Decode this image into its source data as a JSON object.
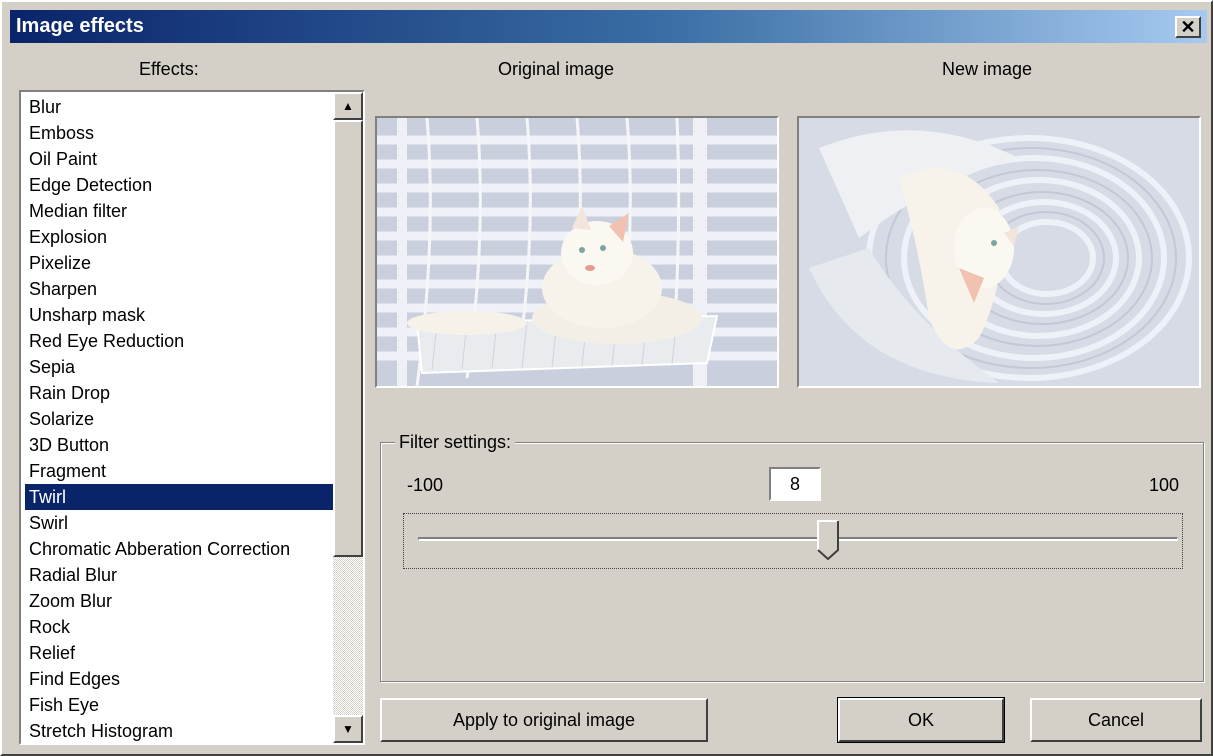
{
  "window": {
    "title": "Image effects",
    "close_glyph": "✕"
  },
  "headers": {
    "effects": "Effects:",
    "original": "Original image",
    "new": "New image"
  },
  "effects": {
    "items": [
      "Blur",
      "Emboss",
      "Oil Paint",
      "Edge Detection",
      "Median filter",
      "Explosion",
      "Pixelize",
      "Sharpen",
      "Unsharp mask",
      "Red Eye Reduction",
      "Sepia",
      "Rain Drop",
      "Solarize",
      "3D Button",
      "Fragment",
      "Twirl",
      "Swirl",
      "Chromatic Abberation Correction",
      "Radial Blur",
      "Zoom Blur",
      "Rock",
      "Relief",
      "Find Edges",
      "Fish Eye",
      "Stretch Histogram"
    ],
    "selected": "Twirl"
  },
  "filter": {
    "label": "Filter settings:",
    "min": "-100",
    "max": "100",
    "value": "8",
    "slider_value": 8,
    "slider_min": -100,
    "slider_max": 100
  },
  "buttons": {
    "apply": "Apply to original image",
    "ok": "OK",
    "cancel": "Cancel"
  },
  "icons": {
    "scroll_up": "scroll-up-arrow-icon",
    "scroll_down": "scroll-down-arrow-icon"
  },
  "colors": {
    "selection": "#0a246a",
    "title_start": "#0a246a",
    "title_end": "#a6caf0",
    "face": "#d4d0c8"
  }
}
